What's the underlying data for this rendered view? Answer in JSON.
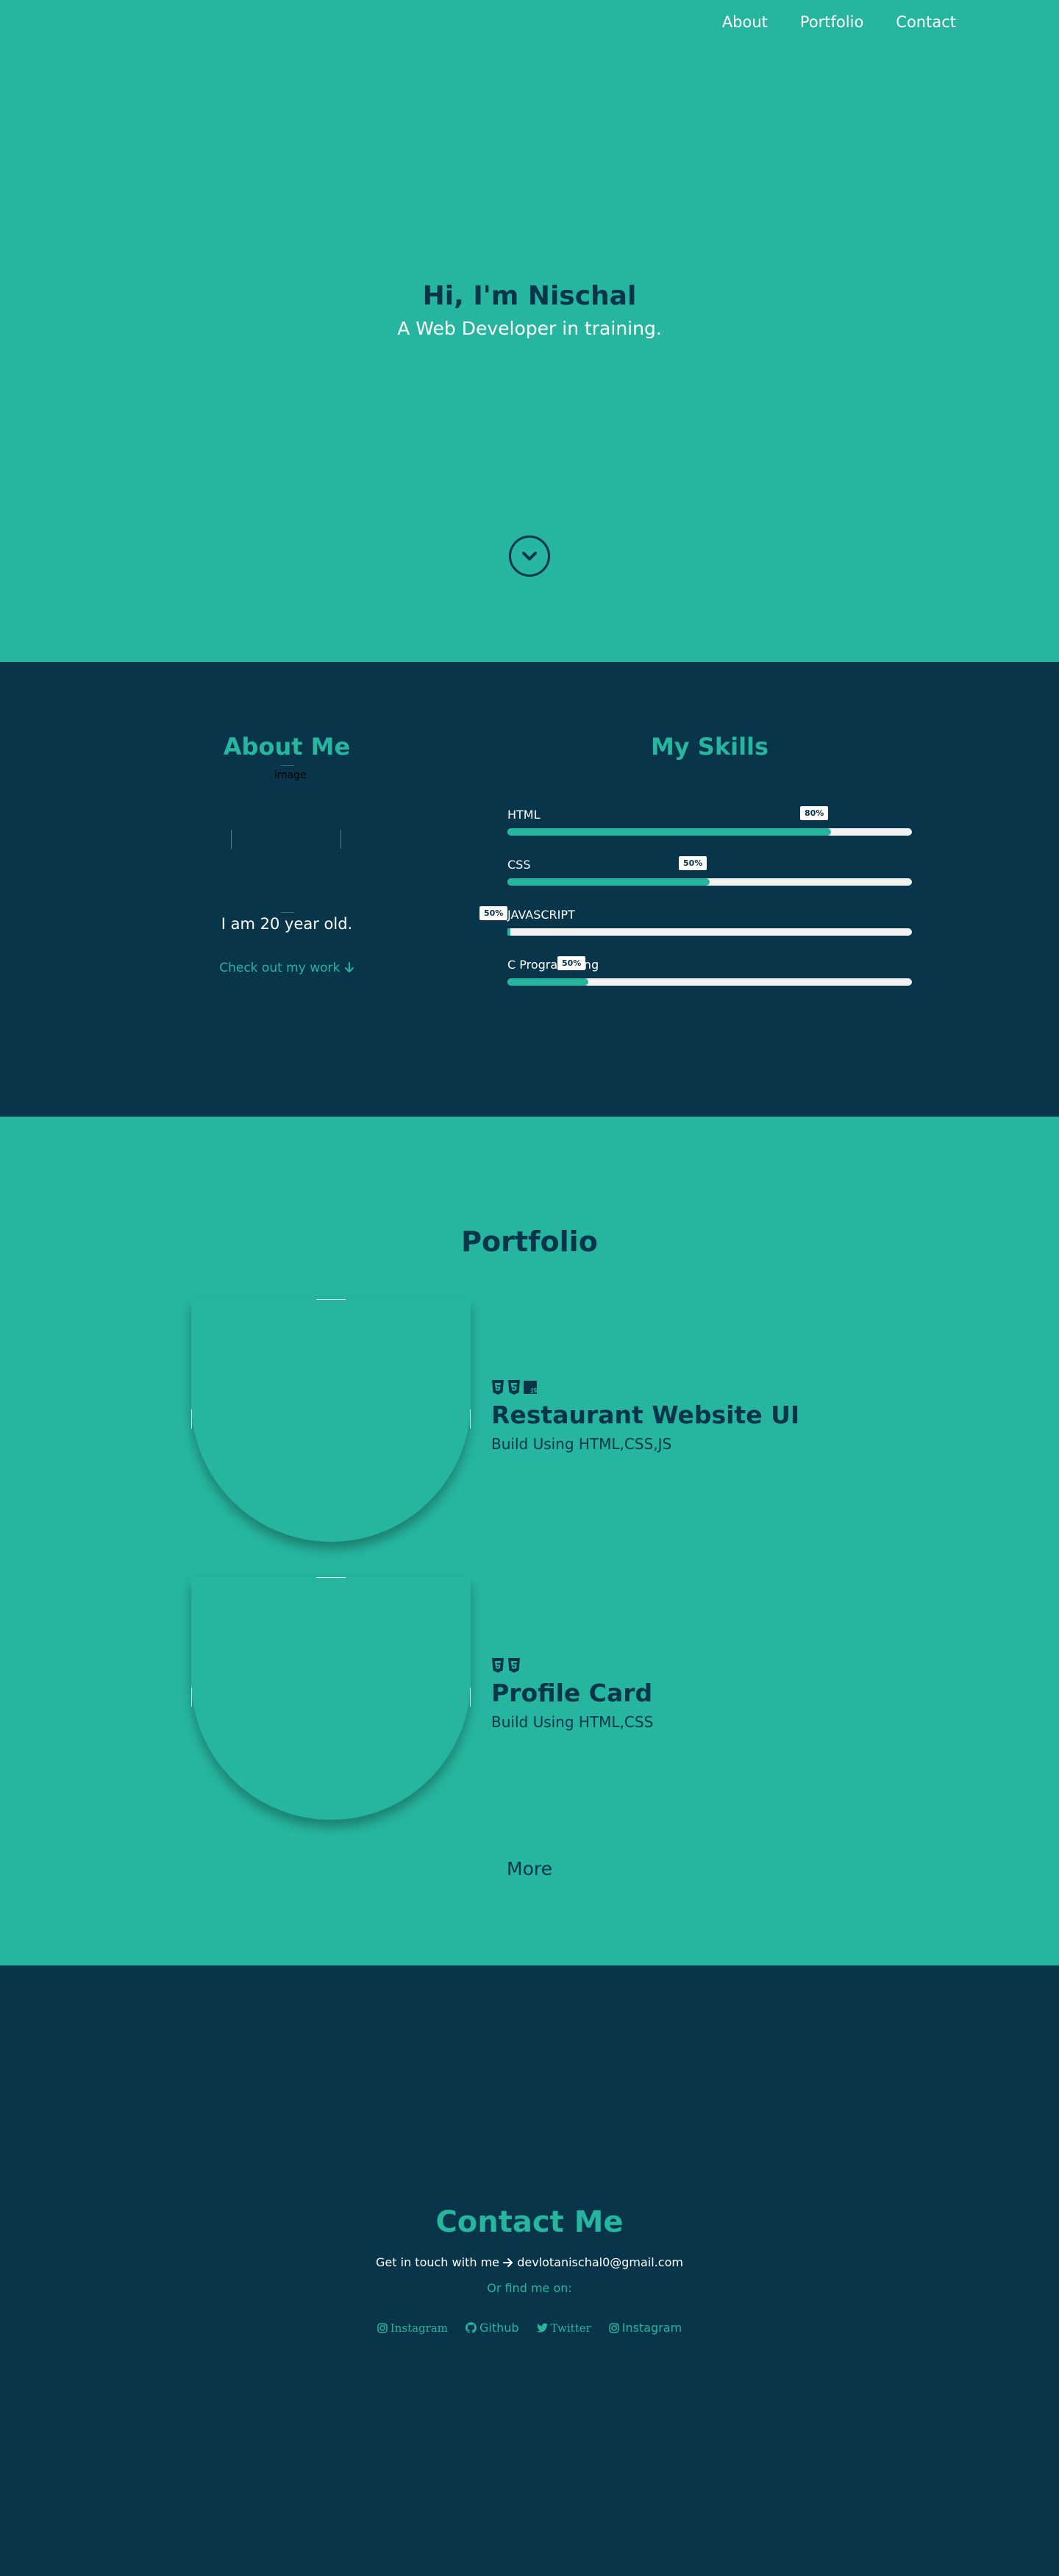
{
  "nav": {
    "items": [
      "About",
      "Portfolio",
      "Contact"
    ]
  },
  "hero": {
    "title": "Hi, I'm Nischal",
    "subtitle": "A Web Developer in training."
  },
  "about": {
    "title": "About Me",
    "image_alt": "image",
    "age_text": "I am 20 year old.",
    "check_work": "Check out my work"
  },
  "skills": {
    "title": "My Skills",
    "items": [
      {
        "name": "HTML",
        "percent_label": "80%",
        "level": 0.8
      },
      {
        "name": "CSS",
        "percent_label": "50%",
        "level": 0.5
      },
      {
        "name": "JAVASCRIPT",
        "percent_label": "50%",
        "level": 0.0
      },
      {
        "name": "C Programming",
        "percent_label": "50%",
        "level": 0.2
      }
    ]
  },
  "portfolio": {
    "title": "Portfolio",
    "projects": [
      {
        "name": "Restaurant Website UI",
        "desc": "Build Using HTML,CSS,JS",
        "tech_icons": [
          "html5-icon",
          "css3-icon",
          "js-icon"
        ]
      },
      {
        "name": "Profile Card",
        "desc": "Build Using HTML,CSS",
        "tech_icons": [
          "html5-icon",
          "css3-icon"
        ]
      }
    ],
    "more_label": "More"
  },
  "contact": {
    "title": "Contact Me",
    "line_prefix": "Get in touch with me",
    "email": "devlotanischal0@gmail.com",
    "find_me": "Or find me on:",
    "socials": [
      {
        "label": "Instagram",
        "icon": "instagram-icon"
      },
      {
        "label": "Github",
        "icon": "github-icon"
      },
      {
        "label": "Twitter",
        "icon": "twitter-icon"
      },
      {
        "label": "Instagram",
        "icon": "instagram-icon"
      }
    ]
  },
  "colors": {
    "teal": "#26b59e",
    "navy": "#083549"
  }
}
